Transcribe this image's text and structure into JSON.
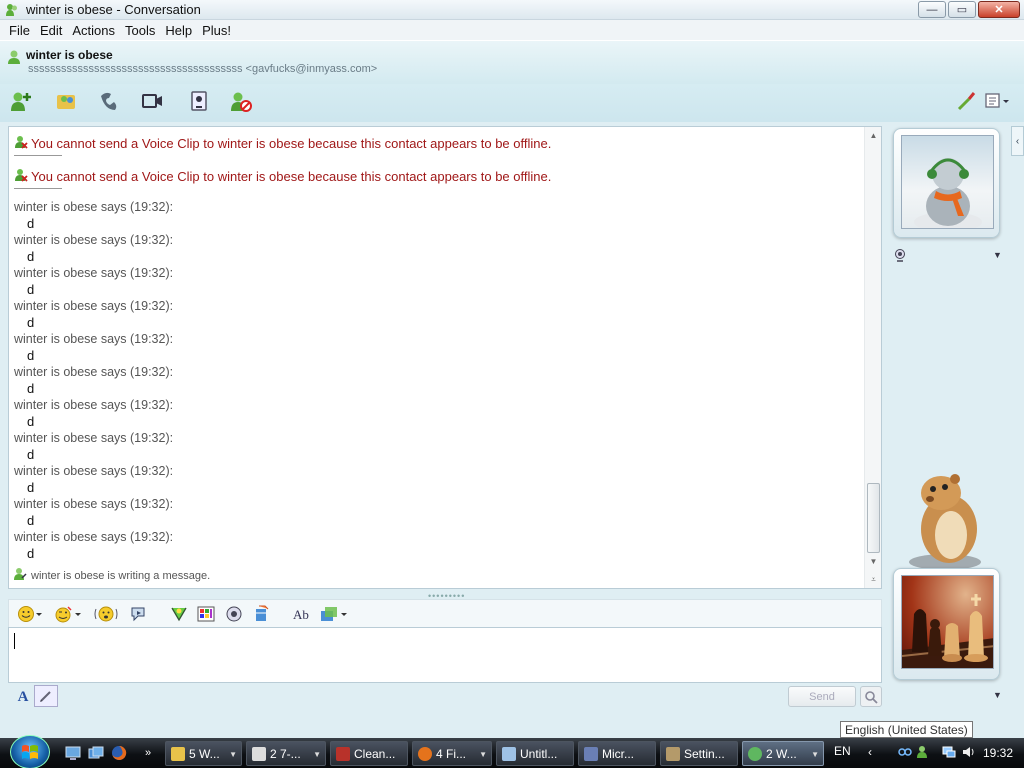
{
  "window": {
    "title": "winter is obese - Conversation"
  },
  "menu": [
    "File",
    "Edit",
    "Actions",
    "Tools",
    "Help",
    "Plus!"
  ],
  "contact": {
    "name": "winter is obese",
    "personal_message": "sssssssssssssssssssssssssssssssssssssss <gavfucks@inmyass.com>"
  },
  "chat": {
    "system_messages": [
      "You cannot send a Voice Clip to winter is obese because this contact appears to be offline.",
      "You cannot send a Voice Clip to winter is obese because this contact appears to be offline."
    ],
    "messages": [
      {
        "header": "winter is obese says (19:32):",
        "text": "d"
      },
      {
        "header": "winter is obese says (19:32):",
        "text": "d"
      },
      {
        "header": "winter is obese says (19:32):",
        "text": "d"
      },
      {
        "header": "winter is obese says (19:32):",
        "text": "d"
      },
      {
        "header": "winter is obese says (19:32):",
        "text": "d"
      },
      {
        "header": "winter is obese says (19:32):",
        "text": "d"
      },
      {
        "header": "winter is obese says (19:32):",
        "text": "d"
      },
      {
        "header": "winter is obese says (19:32):",
        "text": "d"
      },
      {
        "header": "winter is obese says (19:32):",
        "text": "d"
      },
      {
        "header": "winter is obese says (19:32):",
        "text": "d"
      },
      {
        "header": "winter is obese says (19:32):",
        "text": "d"
      }
    ],
    "typing_status": "winter is obese is writing a message."
  },
  "compose": {
    "send_label": "Send",
    "input_value": ""
  },
  "tooltip": "English (United States)",
  "taskbar": {
    "tasks": [
      {
        "label": "5 W...",
        "color": "#e8c24a"
      },
      {
        "label": "2 7-...",
        "color": "#dddddd"
      },
      {
        "label": "Clean...",
        "color": "#b8322a"
      },
      {
        "label": "4 Fi...",
        "color": "#e5731c"
      },
      {
        "label": "Untitl...",
        "color": "#9ec2e6"
      },
      {
        "label": "Micr...",
        "color": "#6a7fb5"
      },
      {
        "label": "Settin...",
        "color": "#b49a6a"
      },
      {
        "label": "2 W...",
        "color": "#5fb760"
      }
    ],
    "language": "EN",
    "clock": "19:32"
  }
}
